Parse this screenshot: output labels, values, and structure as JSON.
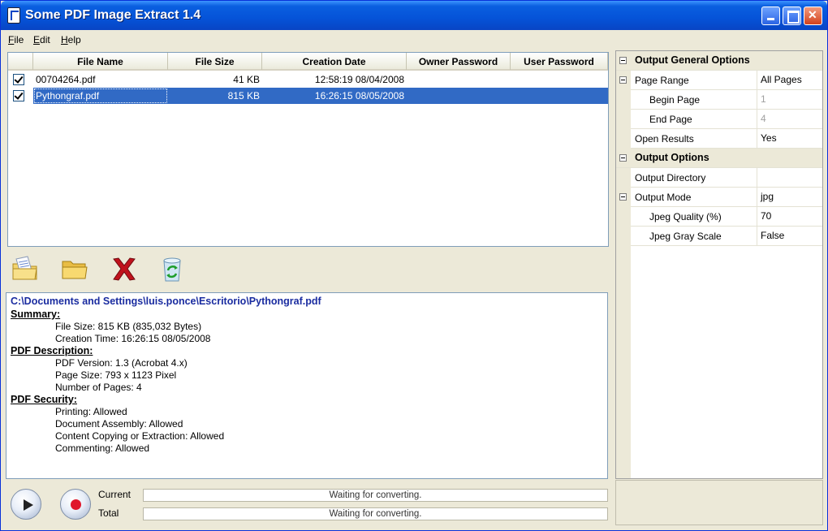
{
  "window": {
    "title": "Some PDF Image Extract 1.4"
  },
  "menu": [
    {
      "mnemonic": "F",
      "rest": "ile"
    },
    {
      "mnemonic": "E",
      "rest": "dit"
    },
    {
      "mnemonic": "H",
      "rest": "elp"
    }
  ],
  "file_list": {
    "columns": [
      "File Name",
      "File Size",
      "Creation Date",
      "Owner Password",
      "User Password"
    ],
    "rows": [
      {
        "checked": true,
        "name": "00704264.pdf",
        "size": "41 KB",
        "date": "12:58:19 08/04/2008",
        "owner": "",
        "user": "",
        "selected": false
      },
      {
        "checked": true,
        "name": "Pythongraf.pdf",
        "size": "815 KB",
        "date": "16:26:15 08/05/2008",
        "owner": "",
        "user": "",
        "selected": true
      }
    ]
  },
  "toolbar": {
    "icons": [
      "add-files-icon",
      "open-folder-icon",
      "delete-icon",
      "recycle-icon"
    ]
  },
  "info": {
    "path": "C:\\Documents and Settings\\luis.ponce\\Escritorio\\Pythongraf.pdf",
    "summary_title": "Summary:",
    "summary": [
      "File Size: 815 KB (835,032 Bytes)",
      "Creation Time: 16:26:15 08/05/2008"
    ],
    "description_title": "PDF Description:",
    "description": [
      "PDF Version: 1.3 (Acrobat 4.x)",
      "Page Size: 793 x 1123 Pixel",
      "Number of Pages: 4"
    ],
    "security_title": "PDF Security:",
    "security": [
      "Printing: Allowed",
      "Document Assembly: Allowed",
      "Content Copying or Extraction: Allowed",
      "Commenting: Allowed"
    ]
  },
  "progress": {
    "current_label": "Current",
    "total_label": "Total",
    "current_text": "Waiting for converting.",
    "total_text": "Waiting for converting."
  },
  "properties": {
    "general_title": "Output General Options",
    "page_range_label": "Page Range",
    "page_range_value": "All Pages",
    "begin_page_label": "Begin Page",
    "begin_page_value": "1",
    "end_page_label": "End Page",
    "end_page_value": "4",
    "open_results_label": "Open Results",
    "open_results_value": "Yes",
    "output_title": "Output Options",
    "output_dir_label": "Output Directory",
    "output_dir_value": "",
    "output_mode_label": "Output Mode",
    "output_mode_value": "jpg",
    "jpeg_quality_label": "Jpeg Quality (%)",
    "jpeg_quality_value": "70",
    "jpeg_gray_label": "Jpeg Gray Scale",
    "jpeg_gray_value": "False"
  },
  "colors": {
    "title_bar": "#0553d8",
    "selection": "#316ac5",
    "path_text": "#1a2ca0"
  }
}
